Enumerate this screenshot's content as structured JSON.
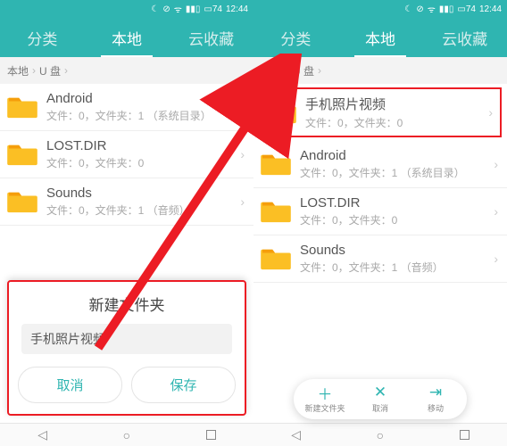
{
  "status": {
    "time": "12:44",
    "battery": "74"
  },
  "tabs": [
    "分类",
    "本地",
    "云收藏"
  ],
  "breadcrumb": [
    "本地",
    "U 盘"
  ],
  "left": {
    "items": [
      {
        "name": "Android",
        "sub": "文件：0，文件夹：1    （系统目录）"
      },
      {
        "name": "LOST.DIR",
        "sub": "文件：0，文件夹：0"
      },
      {
        "name": "Sounds",
        "sub": "文件：0，文件夹：1    （音频）"
      }
    ],
    "dialog": {
      "title": "新建文件夹",
      "input": "手机照片视频",
      "cancel": "取消",
      "save": "保存"
    }
  },
  "right": {
    "items": [
      {
        "name": "手机照片视频",
        "sub": "文件：0，文件夹：0",
        "hl": true
      },
      {
        "name": "Android",
        "sub": "文件：0，文件夹：1    （系统目录）"
      },
      {
        "name": "LOST.DIR",
        "sub": "文件：0，文件夹：0"
      },
      {
        "name": "Sounds",
        "sub": "文件：0，文件夹：1    （音频）"
      }
    ],
    "actions": {
      "new": "新建文件夹",
      "cancel": "取消",
      "move": "移动"
    }
  }
}
